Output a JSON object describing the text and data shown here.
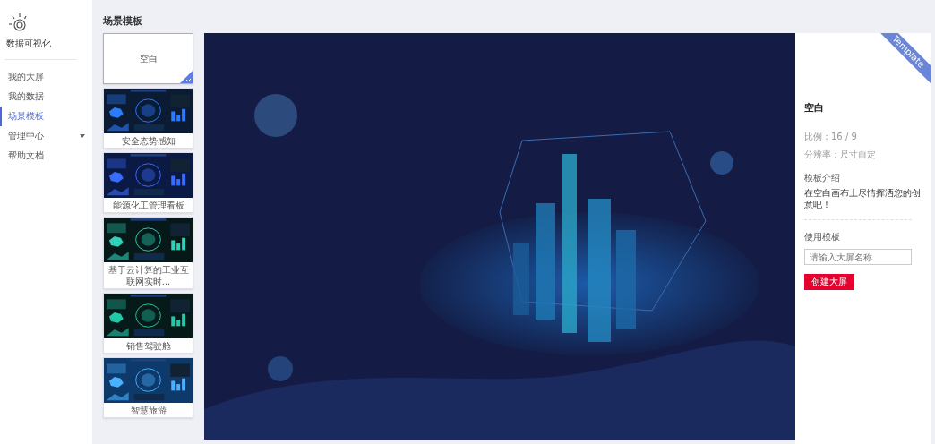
{
  "sidebar": {
    "logo_text": "数据可视化",
    "items": [
      {
        "label": "我的大屏",
        "selected": false
      },
      {
        "label": "我的数据",
        "selected": false
      },
      {
        "label": "场景模板",
        "selected": true
      },
      {
        "label": "管理中心",
        "selected": false,
        "expandable": true,
        "expanded": false
      },
      {
        "label": "帮助文档",
        "selected": false
      }
    ]
  },
  "page_title": "场景模板",
  "templates": [
    {
      "kind": "blank",
      "label": "空白",
      "selected": true
    },
    {
      "kind": "picture",
      "label": "安全态势感知",
      "selected": false
    },
    {
      "kind": "picture",
      "label": "能源化工管理看板",
      "selected": false
    },
    {
      "kind": "picture",
      "label": "基于云计算的工业互联网实时...",
      "selected": false
    },
    {
      "kind": "picture",
      "label": "销售驾驶舱",
      "selected": false
    },
    {
      "kind": "picture",
      "label": "智慧旅游",
      "selected": false
    }
  ],
  "details": {
    "ribbon": "Template",
    "name": "空白",
    "ratio": "比例：16 / 9",
    "resolution": "分辨率：尺寸自定",
    "intro_title": "模板介绍",
    "intro": "在空白画布上尽情挥洒您的创意吧！",
    "use_title": "使用模板",
    "name_field": {
      "placeholder": "请输入大屏名称"
    },
    "create_button": "创建大屏"
  }
}
